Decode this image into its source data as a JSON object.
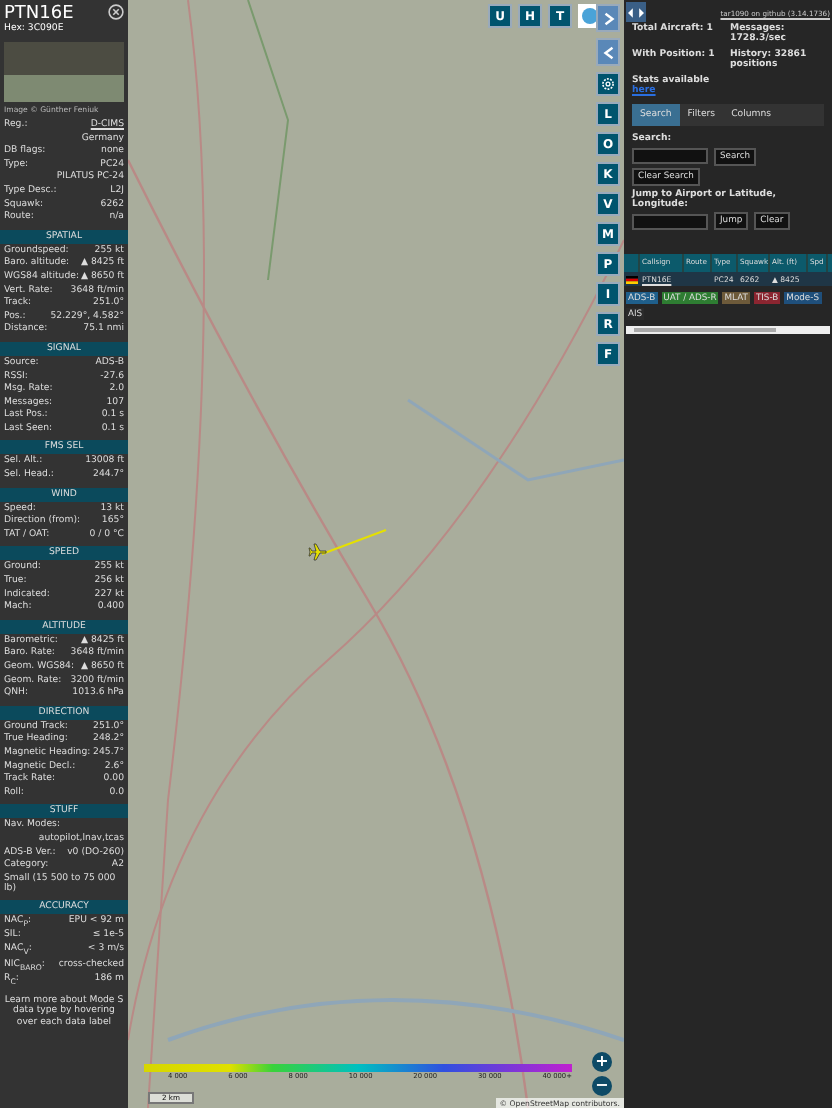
{
  "aircraft_panel": {
    "callsign": "PTN16E",
    "hex": "Hex: 3C090E",
    "photo_credit": "Image © Günther Feniuk",
    "details": [
      {
        "kind": "link",
        "label": "Reg.:",
        "value": "D-CIMS"
      },
      {
        "kind": "value",
        "value": "Germany"
      },
      {
        "kind": "pair",
        "label": "DB flags:",
        "value": "none"
      },
      {
        "kind": "pair",
        "label": "Type:",
        "value": "PC24"
      },
      {
        "kind": "value",
        "value": "PILATUS PC-24"
      },
      {
        "kind": "pair",
        "label": "Type Desc.:",
        "value": "L2J"
      },
      {
        "kind": "pair",
        "label": "Squawk:",
        "value": "6262"
      },
      {
        "kind": "pair",
        "label": "Route:",
        "value": "n/a"
      }
    ],
    "sections": [
      {
        "title": "SPATIAL",
        "rows": [
          {
            "kind": "pair",
            "label": "Groundspeed:",
            "value": "255 kt"
          },
          {
            "kind": "pair",
            "label": "Baro. altitude:",
            "value": "▲ 8425 ft"
          },
          {
            "kind": "pair",
            "label": "WGS84 altitude:",
            "value": "▲ 8650 ft"
          },
          {
            "kind": "pair",
            "label": "Vert. Rate:",
            "value": "3648 ft/min"
          },
          {
            "kind": "pair",
            "label": "Track:",
            "value": "251.0°"
          },
          {
            "kind": "pair",
            "label": "Pos.:",
            "value": "52.229°, 4.582°"
          },
          {
            "kind": "pair",
            "label": "Distance:",
            "value": "75.1 nmi"
          }
        ]
      },
      {
        "title": "SIGNAL",
        "rows": [
          {
            "kind": "pair",
            "label": "Source:",
            "value": "ADS-B"
          },
          {
            "kind": "pair",
            "label": "RSSI:",
            "value": "-27.6"
          },
          {
            "kind": "pair",
            "label": "Msg. Rate:",
            "value": "2.0"
          },
          {
            "kind": "pair",
            "label": "Messages:",
            "value": "107"
          },
          {
            "kind": "pair",
            "label": "Last Pos.:",
            "value": "0.1 s"
          },
          {
            "kind": "pair",
            "label": "Last Seen:",
            "value": "0.1 s"
          }
        ]
      },
      {
        "title": "FMS SEL",
        "rows": [
          {
            "kind": "pair",
            "label": "Sel. Alt.:",
            "value": "13008 ft"
          },
          {
            "kind": "pair",
            "label": "Sel. Head.:",
            "value": "244.7°"
          }
        ]
      },
      {
        "title": "WIND",
        "rows": [
          {
            "kind": "pair",
            "label": "Speed:",
            "value": "13 kt"
          },
          {
            "kind": "pair",
            "label": "Direction (from):",
            "value": "165°"
          },
          {
            "kind": "pair",
            "label": "TAT / OAT:",
            "value": "0 / 0 °C"
          }
        ]
      },
      {
        "title": "SPEED",
        "rows": [
          {
            "kind": "pair",
            "label": "Ground:",
            "value": "255 kt"
          },
          {
            "kind": "pair",
            "label": "True:",
            "value": "256 kt"
          },
          {
            "kind": "pair",
            "label": "Indicated:",
            "value": "227 kt"
          },
          {
            "kind": "pair",
            "label": "Mach:",
            "value": "0.400"
          }
        ]
      },
      {
        "title": "ALTITUDE",
        "rows": [
          {
            "kind": "pair",
            "label": "Barometric:",
            "value": "▲ 8425 ft"
          },
          {
            "kind": "pair",
            "label": "Baro. Rate:",
            "value": "3648 ft/min"
          },
          {
            "kind": "pair",
            "label": "Geom. WGS84:",
            "value": "▲ 8650 ft"
          },
          {
            "kind": "pair",
            "label": "Geom. Rate:",
            "value": "3200 ft/min"
          },
          {
            "kind": "pair",
            "label": "QNH:",
            "value": "1013.6 hPa"
          }
        ]
      },
      {
        "title": "DIRECTION",
        "rows": [
          {
            "kind": "pair",
            "label": "Ground Track:",
            "value": "251.0°"
          },
          {
            "kind": "pair",
            "label": "True Heading:",
            "value": "248.2°"
          },
          {
            "kind": "pair",
            "label": "Magnetic Heading:",
            "value": "245.7°"
          },
          {
            "kind": "pair",
            "label": "Magnetic Decl.:",
            "value": "2.6°"
          },
          {
            "kind": "pair",
            "label": "Track Rate:",
            "value": "0.00"
          },
          {
            "kind": "pair",
            "label": "Roll:",
            "value": "0.0"
          }
        ]
      },
      {
        "title": "STUFF",
        "rows": [
          {
            "kind": "pair",
            "label": "Nav. Modes:",
            "value": ""
          },
          {
            "kind": "value",
            "value": "autopilot,lnav,tcas"
          },
          {
            "kind": "pair",
            "label": "ADS-B Ver.:",
            "value": "v0 (DO-260)"
          },
          {
            "kind": "pair",
            "label": "Category:",
            "value": "A2"
          },
          {
            "kind": "text",
            "value": "Small (15 500 to 75 000 lb)"
          }
        ]
      },
      {
        "title": "ACCURACY",
        "rows": [
          {
            "kind": "pair",
            "label": "NAC$_{P}$:",
            "value": "EPU < 92 m"
          },
          {
            "kind": "pair",
            "label": "SIL:",
            "value": "≤ 1e-5"
          },
          {
            "kind": "pair",
            "label": "NAC$_{V}$:",
            "value": "< 3 m/s"
          },
          {
            "kind": "pair",
            "label": "NIC$_{BARO}$:",
            "value": "cross-checked"
          },
          {
            "kind": "pair",
            "label": "R$_{C}$:",
            "value": "186 m"
          }
        ]
      }
    ],
    "footnote": "Learn more about Mode S data type by hovering over each data label"
  },
  "map": {
    "top_buttons": [
      "U",
      "H",
      "T"
    ],
    "side_buttons": [
      "L",
      "O",
      "K",
      "V",
      "M",
      "P",
      "I",
      "R",
      "F"
    ],
    "altitude_labels": [
      "4 000",
      "6 000",
      "8 000",
      "10 000",
      "20 000",
      "30 000",
      "40 000+"
    ],
    "scale": "2 km",
    "attribution": "© OpenStreetMap contributors.",
    "zoom_in": "+",
    "zoom_out": "−"
  },
  "list_panel": {
    "version_link": "tar1090 on github (3.14.1736)",
    "stats": [
      "Total Aircraft: 1",
      "Messages: 1728.3/sec",
      "With Position: 1",
      "History: 32861 positions"
    ],
    "stats_text": "Stats available",
    "stats_link": "here",
    "tabs": [
      {
        "label": "Search",
        "selected": true
      },
      {
        "label": "Filters",
        "selected": false
      },
      {
        "label": "Columns",
        "selected": false
      }
    ],
    "search_label": "Search:",
    "search_button": "Search",
    "clear_search_button": "Clear Search",
    "jump_label": "Jump to Airport or Latitude, Longitude:",
    "jump_button": "Jump",
    "clear_button": "Clear",
    "columns": [
      "Callsign",
      "Route",
      "Type",
      "Squawk",
      "Alt. (ft)",
      "Spd"
    ],
    "rows": [
      {
        "callsign": "PTN16E",
        "route": "",
        "type": "PC24",
        "squawk": "6262",
        "alt": "▲ 8425"
      }
    ],
    "legend": [
      {
        "label": "ADS-B",
        "color": "#1f5f8b"
      },
      {
        "label": "UAT / ADS-R",
        "color": "#2e7d32"
      },
      {
        "label": "MLAT",
        "color": "#6d5a3a"
      },
      {
        "label": "TIS-B",
        "color": "#8b2530"
      },
      {
        "label": "Mode-S",
        "color": "#1f4f7b"
      },
      {
        "label": "AIS",
        "color": "#2b2b2b"
      }
    ]
  }
}
